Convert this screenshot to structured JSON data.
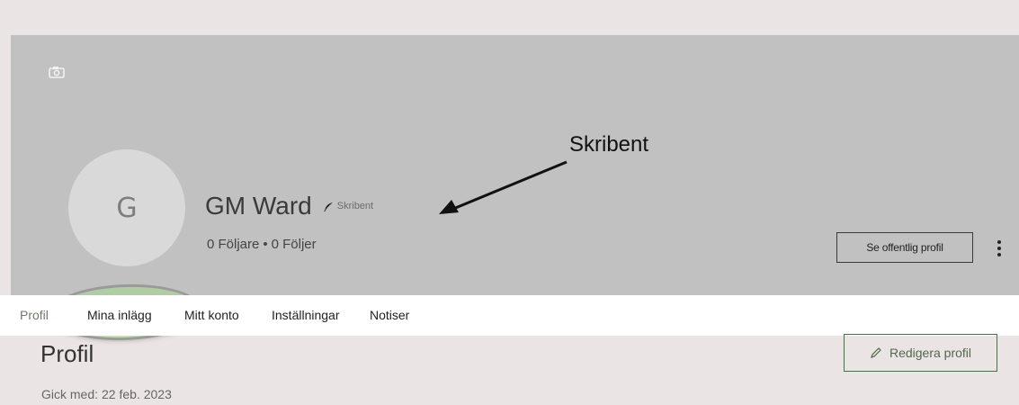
{
  "profile": {
    "avatar_letter": "G",
    "name": "GM Ward",
    "role_badge": "Skribent",
    "followers": "0 Följare",
    "separator": "•",
    "following": "0 Följer",
    "view_public_label": "Se offentlig profil",
    "more_icon": "vertical-dots-icon",
    "camera_icon": "camera-icon"
  },
  "annotation": {
    "label": "Skribent"
  },
  "tabs": [
    {
      "label": "Profil"
    },
    {
      "label": "Mina inlägg"
    },
    {
      "label": "Mitt konto"
    },
    {
      "label": "Inställningar"
    },
    {
      "label": "Notiser"
    }
  ],
  "main": {
    "title": "Profil",
    "joined_label": "Gick med:",
    "joined_date": "22 feb. 2023",
    "edit_label": "Redigera profil",
    "edit_icon": "pencil-icon"
  },
  "colors": {
    "cover": "#c1c1c1",
    "page_bg": "#ebe4e4",
    "accent_green": "#50694f",
    "highlight": "#a0d68c"
  }
}
